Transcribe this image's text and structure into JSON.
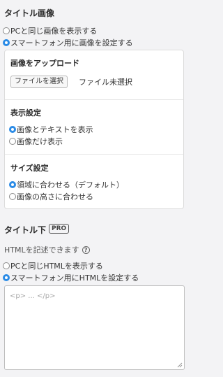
{
  "title_image": {
    "heading": "タイトル画像",
    "options": [
      {
        "label": "PCと同じ画像を表示する",
        "checked": false
      },
      {
        "label": "スマートフォン用に画像を設定する",
        "checked": true
      }
    ]
  },
  "image_upload": {
    "heading": "画像をアップロード",
    "button_label": "ファイルを選択",
    "status": "ファイル未選択"
  },
  "display_settings": {
    "heading": "表示設定",
    "options": [
      {
        "label": "画像とテキストを表示",
        "checked": true
      },
      {
        "label": "画像だけ表示",
        "checked": false
      }
    ]
  },
  "size_settings": {
    "heading": "サイズ設定",
    "options": [
      {
        "label": "領域に合わせる（デフォルト）",
        "checked": true
      },
      {
        "label": "画像の高さに合わせる",
        "checked": false
      }
    ]
  },
  "below_title": {
    "heading": "タイトル下",
    "badge": "PRO",
    "note": "HTMLを記述できます",
    "help_icon": "question-circle-icon",
    "options": [
      {
        "label": "PCと同じHTMLを表示する",
        "checked": false
      },
      {
        "label": "スマートフォン用にHTMLを設定する",
        "checked": true
      }
    ],
    "textarea_placeholder": "<p> ... </p>"
  },
  "colors": {
    "accent": "#2b8be6",
    "background": "#f3f3f5"
  }
}
